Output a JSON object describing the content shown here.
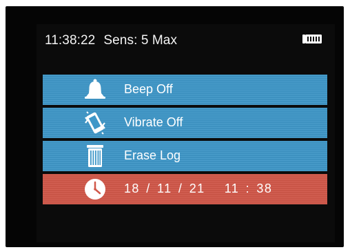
{
  "status": {
    "time": "11:38:22",
    "sensitivity": "Sens: 5 Max",
    "battery_icon": "battery-full-icon"
  },
  "menu": {
    "items": [
      {
        "label": "Beep Off",
        "icon": "bell-icon",
        "selected": false
      },
      {
        "label": "Vibrate Off",
        "icon": "vibrate-phone-icon",
        "selected": false
      },
      {
        "label": "Erase Log",
        "icon": "trash-can-icon",
        "selected": false
      },
      {
        "label": "18 / 11 / 21   11 : 38",
        "icon": "clock-icon",
        "selected": true
      }
    ]
  },
  "colors": {
    "item_blue": "#3f97c8",
    "item_selected_red": "#d1584a",
    "screen_background": "#0b0b0b",
    "text": "#ffffff"
  }
}
